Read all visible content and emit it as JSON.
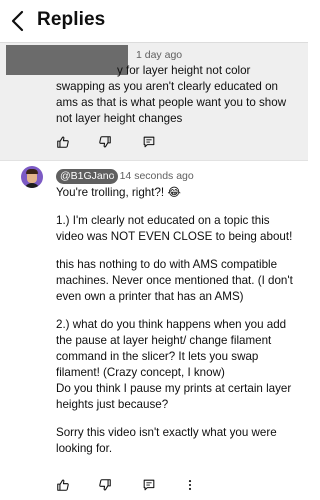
{
  "header": {
    "title": "Replies"
  },
  "parent_comment": {
    "time": "1 day ago",
    "lines": [
      "y for layer height not color",
      "swapping as you aren't clearly educated on",
      "ams as that is what people want you to show",
      "not layer height changes"
    ]
  },
  "reply": {
    "handle": "@B1GJano",
    "time": "• 14 seconds ago",
    "paragraphs": [
      [
        "You're trolling, right?! 😂"
      ],
      [
        "1.) I'm clearly not educated on a topic this",
        "video was NOT EVEN CLOSE to being about!"
      ],
      [
        "this has nothing to do with AMS compatible",
        "machines. Never once mentioned that. (I don't",
        "even own a printer that has an AMS)"
      ],
      [
        "2.) what do you think happens when you add",
        "the pause at layer height/ change filament",
        "command in the slicer? It lets you swap",
        "filament! (Crazy concept, I know)",
        "Do you think I pause my prints at certain layer",
        "heights just because?"
      ],
      [
        "Sorry this video isn't exactly what you were",
        "looking for."
      ]
    ]
  },
  "actions": [
    "like",
    "dislike",
    "reply"
  ]
}
